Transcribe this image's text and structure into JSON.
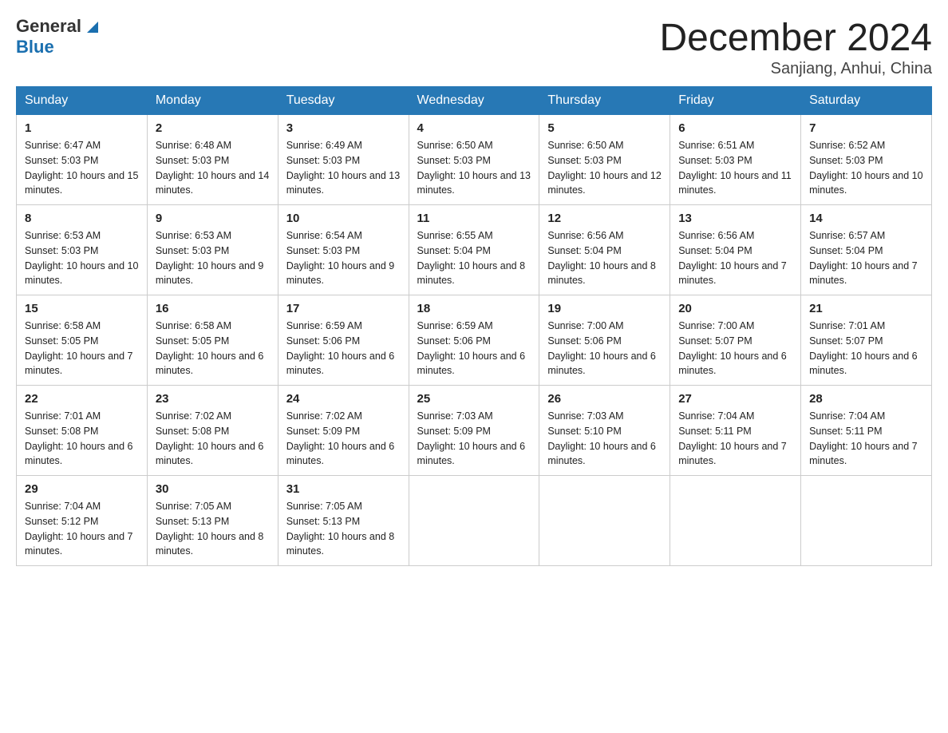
{
  "header": {
    "logo_general": "General",
    "logo_blue": "Blue",
    "month_title": "December 2024",
    "location": "Sanjiang, Anhui, China"
  },
  "weekdays": [
    "Sunday",
    "Monday",
    "Tuesday",
    "Wednesday",
    "Thursday",
    "Friday",
    "Saturday"
  ],
  "weeks": [
    [
      {
        "day": "1",
        "sunrise": "6:47 AM",
        "sunset": "5:03 PM",
        "daylight": "10 hours and 15 minutes."
      },
      {
        "day": "2",
        "sunrise": "6:48 AM",
        "sunset": "5:03 PM",
        "daylight": "10 hours and 14 minutes."
      },
      {
        "day": "3",
        "sunrise": "6:49 AM",
        "sunset": "5:03 PM",
        "daylight": "10 hours and 13 minutes."
      },
      {
        "day": "4",
        "sunrise": "6:50 AM",
        "sunset": "5:03 PM",
        "daylight": "10 hours and 13 minutes."
      },
      {
        "day": "5",
        "sunrise": "6:50 AM",
        "sunset": "5:03 PM",
        "daylight": "10 hours and 12 minutes."
      },
      {
        "day": "6",
        "sunrise": "6:51 AM",
        "sunset": "5:03 PM",
        "daylight": "10 hours and 11 minutes."
      },
      {
        "day": "7",
        "sunrise": "6:52 AM",
        "sunset": "5:03 PM",
        "daylight": "10 hours and 10 minutes."
      }
    ],
    [
      {
        "day": "8",
        "sunrise": "6:53 AM",
        "sunset": "5:03 PM",
        "daylight": "10 hours and 10 minutes."
      },
      {
        "day": "9",
        "sunrise": "6:53 AM",
        "sunset": "5:03 PM",
        "daylight": "10 hours and 9 minutes."
      },
      {
        "day": "10",
        "sunrise": "6:54 AM",
        "sunset": "5:03 PM",
        "daylight": "10 hours and 9 minutes."
      },
      {
        "day": "11",
        "sunrise": "6:55 AM",
        "sunset": "5:04 PM",
        "daylight": "10 hours and 8 minutes."
      },
      {
        "day": "12",
        "sunrise": "6:56 AM",
        "sunset": "5:04 PM",
        "daylight": "10 hours and 8 minutes."
      },
      {
        "day": "13",
        "sunrise": "6:56 AM",
        "sunset": "5:04 PM",
        "daylight": "10 hours and 7 minutes."
      },
      {
        "day": "14",
        "sunrise": "6:57 AM",
        "sunset": "5:04 PM",
        "daylight": "10 hours and 7 minutes."
      }
    ],
    [
      {
        "day": "15",
        "sunrise": "6:58 AM",
        "sunset": "5:05 PM",
        "daylight": "10 hours and 7 minutes."
      },
      {
        "day": "16",
        "sunrise": "6:58 AM",
        "sunset": "5:05 PM",
        "daylight": "10 hours and 6 minutes."
      },
      {
        "day": "17",
        "sunrise": "6:59 AM",
        "sunset": "5:06 PM",
        "daylight": "10 hours and 6 minutes."
      },
      {
        "day": "18",
        "sunrise": "6:59 AM",
        "sunset": "5:06 PM",
        "daylight": "10 hours and 6 minutes."
      },
      {
        "day": "19",
        "sunrise": "7:00 AM",
        "sunset": "5:06 PM",
        "daylight": "10 hours and 6 minutes."
      },
      {
        "day": "20",
        "sunrise": "7:00 AM",
        "sunset": "5:07 PM",
        "daylight": "10 hours and 6 minutes."
      },
      {
        "day": "21",
        "sunrise": "7:01 AM",
        "sunset": "5:07 PM",
        "daylight": "10 hours and 6 minutes."
      }
    ],
    [
      {
        "day": "22",
        "sunrise": "7:01 AM",
        "sunset": "5:08 PM",
        "daylight": "10 hours and 6 minutes."
      },
      {
        "day": "23",
        "sunrise": "7:02 AM",
        "sunset": "5:08 PM",
        "daylight": "10 hours and 6 minutes."
      },
      {
        "day": "24",
        "sunrise": "7:02 AM",
        "sunset": "5:09 PM",
        "daylight": "10 hours and 6 minutes."
      },
      {
        "day": "25",
        "sunrise": "7:03 AM",
        "sunset": "5:09 PM",
        "daylight": "10 hours and 6 minutes."
      },
      {
        "day": "26",
        "sunrise": "7:03 AM",
        "sunset": "5:10 PM",
        "daylight": "10 hours and 6 minutes."
      },
      {
        "day": "27",
        "sunrise": "7:04 AM",
        "sunset": "5:11 PM",
        "daylight": "10 hours and 7 minutes."
      },
      {
        "day": "28",
        "sunrise": "7:04 AM",
        "sunset": "5:11 PM",
        "daylight": "10 hours and 7 minutes."
      }
    ],
    [
      {
        "day": "29",
        "sunrise": "7:04 AM",
        "sunset": "5:12 PM",
        "daylight": "10 hours and 7 minutes."
      },
      {
        "day": "30",
        "sunrise": "7:05 AM",
        "sunset": "5:13 PM",
        "daylight": "10 hours and 8 minutes."
      },
      {
        "day": "31",
        "sunrise": "7:05 AM",
        "sunset": "5:13 PM",
        "daylight": "10 hours and 8 minutes."
      },
      null,
      null,
      null,
      null
    ]
  ]
}
